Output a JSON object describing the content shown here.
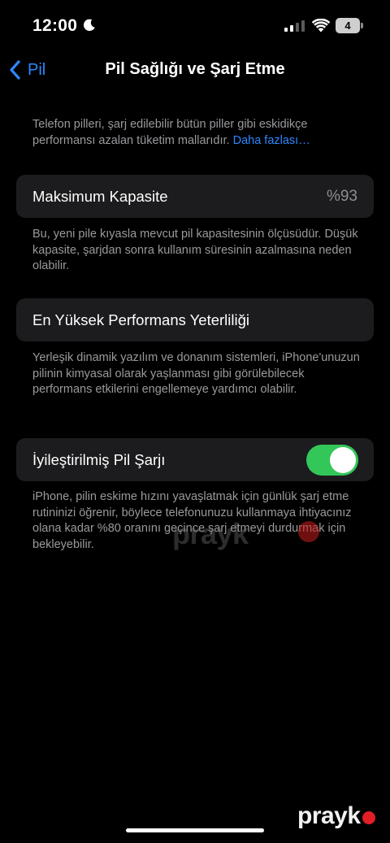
{
  "status_bar": {
    "time": "12:00",
    "battery_level": "4",
    "icons": [
      "moon-icon",
      "signal-icon",
      "wifi-icon",
      "battery-icon"
    ]
  },
  "nav": {
    "back_label": "Pil",
    "title": "Pil Sağlığı ve Şarj Etme"
  },
  "intro": {
    "text": "Telefon pilleri, şarj edilebilir bütün piller gibi eskidikçe performansı azalan tüketim mallarıdır. ",
    "link": "Daha fazlası…"
  },
  "max_capacity": {
    "label": "Maksimum Kapasite",
    "value": "%93",
    "footnote": "Bu, yeni pile kıyasla mevcut pil kapasitesinin ölçüsüdür. Düşük kapasite, şarjdan sonra kullanım süresinin azalmasına neden olabilir."
  },
  "peak_performance": {
    "label": "En Yüksek Performans Yeterliliği",
    "footnote": "Yerleşik dinamik yazılım ve donanım sistemleri, iPhone'unuzun pilinin kimyasal olarak yaşlanması gibi görülebilecek performans etkilerini engellemeye yardımcı olabilir."
  },
  "optimized_charging": {
    "label": "İyileştirilmiş Pil Şarjı",
    "enabled": true,
    "footnote": "iPhone, pilin eskime hızını yavaşlatmak için günlük şarj etme rutininizi öğrenir, böylece telefonunuzu kullanmaya ihtiyacınız olana kadar %80 oranını geçince şarj etmeyi durdurmak için bekleyebilir."
  },
  "watermark": {
    "text": "prayk",
    "logo_text": "prayk"
  },
  "colors": {
    "accent": "#2f86ff",
    "toggle_on": "#33c759",
    "cell_bg": "#1c1c1e",
    "secondary_text": "#9a9a9e",
    "brand_red": "#e21f26"
  }
}
